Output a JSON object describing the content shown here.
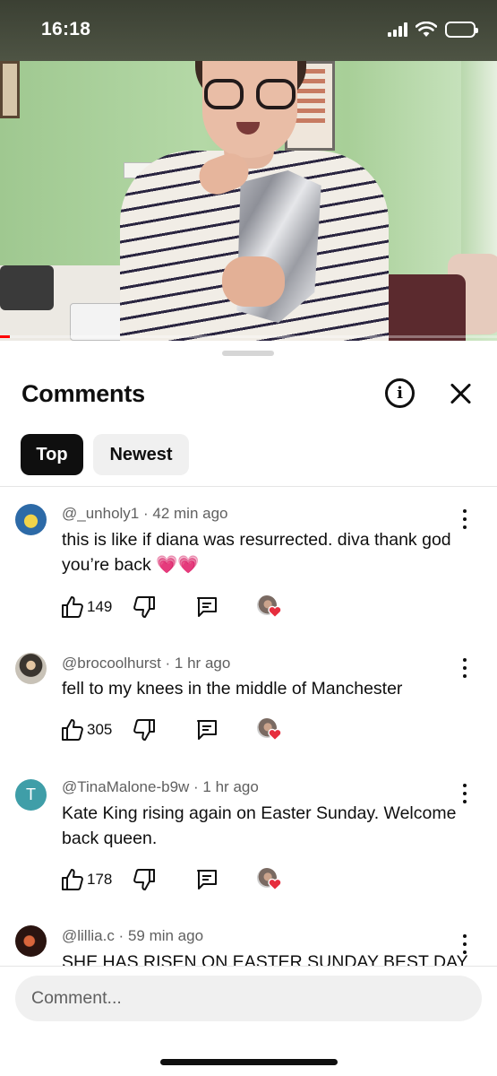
{
  "status_bar": {
    "time": "16:18"
  },
  "video": {
    "progress_fraction": 0.02
  },
  "sheet": {
    "title": "Comments",
    "tabs": [
      {
        "label": "Top",
        "selected": true
      },
      {
        "label": "Newest",
        "selected": false
      }
    ]
  },
  "comments": [
    {
      "handle": "@_unholy1",
      "time": "42 min ago",
      "text": "this is like if diana was resurrected. diva thank god you’re back 💗💗",
      "likes": "149",
      "avatar_icon": "avatar-image"
    },
    {
      "handle": "@brocoolhurst",
      "time": "1 hr ago",
      "text": "fell to my knees in the middle of Manchester",
      "likes": "305",
      "avatar_icon": "avatar-image"
    },
    {
      "handle": "@TinaMalone-b9w",
      "time": "1 hr ago",
      "text": "Kate King rising again on Easter Sunday. Welcome back queen.",
      "likes": "178",
      "avatar_letter": "T"
    },
    {
      "handle": "@lillia.c",
      "time": "59 min ago",
      "text": "SHE HAS RISEN ON EASTER SUNDAY BEST DAY",
      "likes": "",
      "avatar_icon": "avatar-image"
    }
  ],
  "composer": {
    "placeholder": "Comment..."
  },
  "colors": {
    "heart": "#e62e3e",
    "selected_chip_bg": "#0f0f0f",
    "chip_bg": "#f0f0f0",
    "meta_text": "#606060",
    "progress": "#ff0000"
  },
  "icons": [
    "info-icon",
    "close-icon",
    "thumb-up-icon",
    "thumb-down-icon",
    "reply-icon",
    "more-vert-icon",
    "creator-heart-icon"
  ]
}
